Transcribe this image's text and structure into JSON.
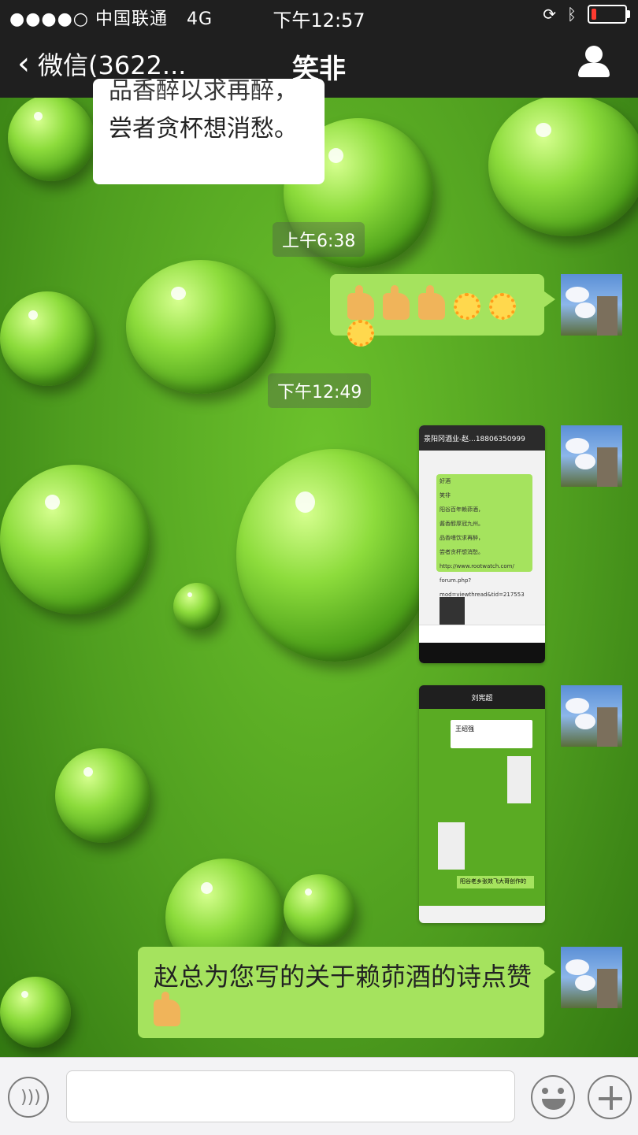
{
  "status_bar": {
    "carrier": "●●●●○ 中国联通",
    "network": "4G",
    "time": "下午12:57"
  },
  "nav": {
    "back_label": "微信(3622...",
    "title": "笑非"
  },
  "messages": {
    "white_bubble": {
      "line1": "品香醉以求再醉，",
      "line2": "尝者贪杯想消愁。"
    },
    "time1": "上午6:38",
    "time2": "下午12:49",
    "final_text": "赵总为您写的关于赖茆酒的诗点赞"
  },
  "screenshot1": {
    "title": "景阳冈酒业-赵...18806350999",
    "msg_lines": [
      "好酒",
      "笑非",
      "阳谷百年赖茆酒，",
      "酱香醇厚冠九州。",
      "品香嗜饮求再醉，",
      "尝者贪杯想消愁。",
      "http://www.rootwatch.com/",
      "forum.php?",
      "mod=viewthread&tid=217553"
    ]
  },
  "screenshot2": {
    "title": "刘宪超",
    "card_name": "王绍强",
    "bubble": "阳谷老乡张效飞大哥创作的"
  },
  "input": {
    "placeholder": ""
  },
  "colors": {
    "bubble_green": "#a5e35e",
    "background_green": "#4f9e1f",
    "topbar": "#1f1f1f"
  },
  "icons": [
    "voice-icon",
    "emoji-icon",
    "plus-icon",
    "user-icon",
    "back-chevron-icon"
  ]
}
